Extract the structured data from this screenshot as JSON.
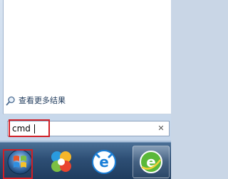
{
  "start_menu": {
    "see_more_label": "查看更多结果",
    "search": {
      "value": "cmd",
      "clear_glyph": "✕"
    }
  },
  "taskbar": {
    "buttons": [
      {
        "name": "start-orb",
        "icon": "windows-logo-icon"
      },
      {
        "name": "pinwheel-app",
        "icon": "pinwheel-icon"
      },
      {
        "name": "browser-e",
        "icon": "blue-e-browser-icon"
      },
      {
        "name": "browser-green-e",
        "icon": "green-e-browser-icon"
      }
    ]
  },
  "colors": {
    "highlight": "#d01f26",
    "taskbar": "#2d4e74"
  }
}
